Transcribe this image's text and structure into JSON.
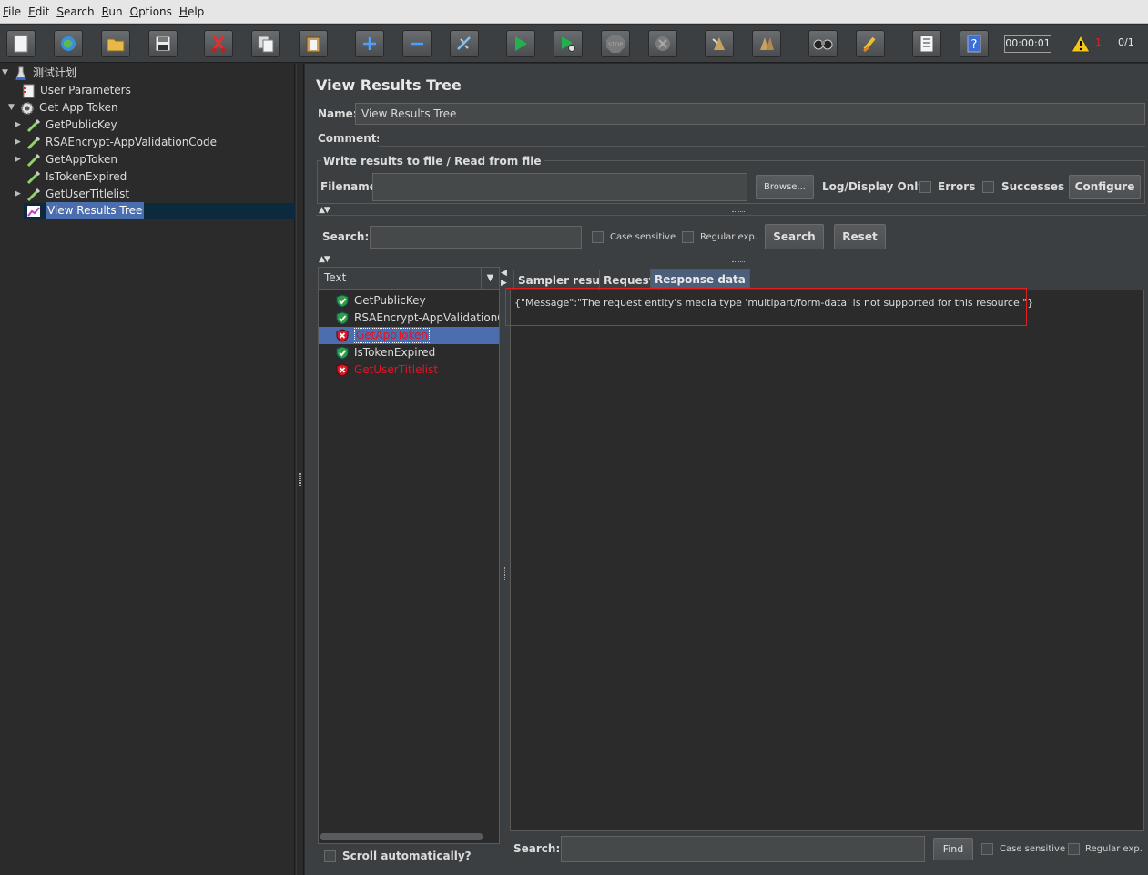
{
  "menu": {
    "file": "File",
    "edit": "Edit",
    "search": "Search",
    "run": "Run",
    "options": "Options",
    "help": "Help"
  },
  "toolbar": {
    "timer": "00:00:01",
    "warning_count": "1",
    "thread_count": "0/1",
    "stop_label": "STOP"
  },
  "tree": {
    "items": [
      {
        "label": "测试计划",
        "icon": "flask-icon"
      },
      {
        "label": "User Parameters",
        "icon": "params-icon"
      },
      {
        "label": "Get App Token",
        "icon": "gear-icon"
      },
      {
        "label": "GetPublicKey",
        "icon": "pipette-icon"
      },
      {
        "label": "RSAEncrypt-AppValidationCode",
        "icon": "pipette-icon"
      },
      {
        "label": "GetAppToken",
        "icon": "pipette-icon"
      },
      {
        "label": "IsTokenExpired",
        "icon": "pipette-icon"
      },
      {
        "label": "GetUserTitlelist",
        "icon": "pipette-icon"
      },
      {
        "label": "View Results Tree",
        "icon": "chart-icon"
      }
    ]
  },
  "panel": {
    "title": "View Results Tree",
    "name_label": "Name:",
    "name_value": "View Results Tree",
    "comments_label": "Comments:",
    "write_section_title": "Write results to file / Read from file",
    "filename_label": "Filename",
    "browse_button": "Browse...",
    "log_display_label": "Log/Display Only:",
    "errors_label": "Errors",
    "successes_label": "Successes",
    "configure_button": "Configure",
    "search_label": "Search:",
    "case_sensitive_label": "Case sensitive",
    "regular_exp_label": "Regular exp.",
    "search_button": "Search",
    "reset_button": "Reset"
  },
  "results": {
    "renderer": "Text",
    "items": [
      {
        "label": "GetPublicKey",
        "status": "ok"
      },
      {
        "label": "RSAEncrypt-AppValidationCode",
        "status": "ok"
      },
      {
        "label": "GetAppToken",
        "status": "error"
      },
      {
        "label": "IsTokenExpired",
        "status": "ok"
      },
      {
        "label": "GetUserTitlelist",
        "status": "error"
      }
    ],
    "scroll_auto_label": "Scroll automatically?"
  },
  "tabs": {
    "sampler_result": "Sampler result",
    "request": "Request",
    "response_data": "Response data"
  },
  "response": {
    "text": "{\"Message\":\"The request entity's media type 'multipart/form-data' is not supported for this resource.\"}",
    "search_label": "Search:",
    "find_button": "Find",
    "case_sensitive_label": "Case sensitive",
    "regular_exp_label": "Regular exp."
  },
  "colors": {
    "error_text": "#e81123",
    "ok_icon": "#2ea043",
    "selection": "#4b6eaf",
    "highlight_border": "#e02020"
  }
}
